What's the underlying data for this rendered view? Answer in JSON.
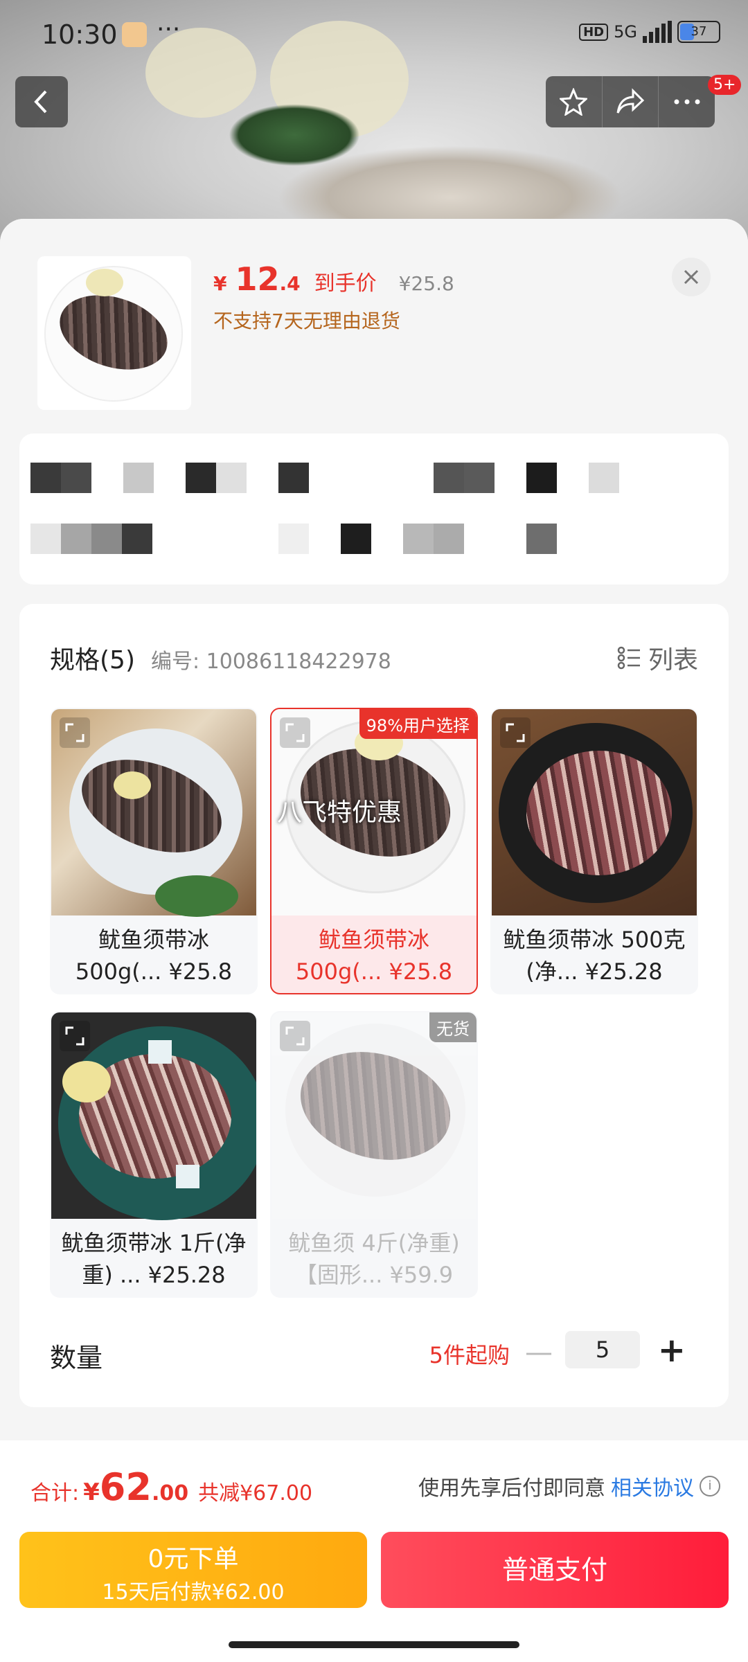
{
  "status_bar": {
    "time": "10:30",
    "dots": "···",
    "hd": "HD",
    "net": "5G",
    "battery": "37"
  },
  "header": {
    "badge": "5+"
  },
  "product": {
    "price_symbol": "¥",
    "price_int": "12",
    "price_dec": ".4",
    "price_tag": "到手价",
    "original_price": "¥25.8",
    "return_policy": "不支持7天无理由退货"
  },
  "spec": {
    "title": "规格(5)",
    "number": "编号: 10086118422978",
    "list_label": "列表",
    "items": [
      {
        "name": "鱿鱼须带冰\n500g(...  ¥25.8",
        "line1": "鱿鱼须带冰",
        "line2": "500g(...  ¥25.8"
      },
      {
        "line1": "鱿鱼须带冰",
        "line2": "500g(...  ¥25.8",
        "ribbon": "98%用户选择",
        "promo": "八飞特优惠"
      },
      {
        "line1": "鱿鱼须带冰 500克",
        "line2": "(净...  ¥25.28"
      },
      {
        "line1": "鱿鱼须带冰 1斤(净",
        "line2": "重) ...  ¥25.28"
      },
      {
        "line1": "鱿鱼须 4斤(净重)",
        "line2": "【固形...  ¥59.9",
        "ribbon": "无货"
      }
    ]
  },
  "quantity": {
    "label": "数量",
    "min_buy": "5件起购",
    "minus": "—",
    "value": "5",
    "plus": "+"
  },
  "footer": {
    "total_label": "合计:",
    "total_symbol": "¥",
    "total_int": "62",
    "total_dec": ".00",
    "saving": "共减¥67.00",
    "agree_text": "使用先享后付即同意",
    "agree_link": "相关协议",
    "info": "i",
    "bnpl_line1": "0元下单",
    "bnpl_line2": "15天后付款¥62.00",
    "pay_label": "普通支付"
  }
}
